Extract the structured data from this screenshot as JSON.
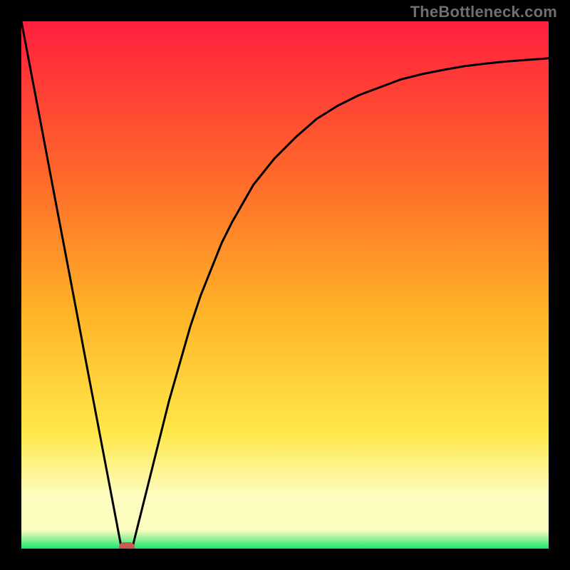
{
  "watermark": "TheBottleneck.com",
  "colors": {
    "frame": "#000000",
    "gradient_top": "#ff1f3e",
    "gradient_mid1": "#ff6a2a",
    "gradient_mid2": "#ffb327",
    "gradient_mid3": "#ffe84a",
    "gradient_lightband": "#fdfdc0",
    "gradient_bottom": "#17e86b",
    "curve": "#000000",
    "watermark": "#6f6f6f",
    "marker": "#c95b54"
  },
  "chart_data": {
    "type": "line",
    "title": "",
    "xlabel": "",
    "ylabel": "",
    "xlim": [
      0,
      100
    ],
    "ylim": [
      0,
      100
    ],
    "x": [
      0,
      2,
      4,
      6,
      8,
      10,
      12,
      14,
      16,
      18,
      19,
      20,
      21,
      22,
      24,
      26,
      28,
      30,
      32,
      34,
      36,
      38,
      40,
      44,
      48,
      52,
      56,
      60,
      64,
      68,
      72,
      76,
      80,
      84,
      88,
      92,
      96,
      100
    ],
    "values": [
      100,
      89.5,
      79,
      68.4,
      57.9,
      47.4,
      36.8,
      26.3,
      15.8,
      5.3,
      0,
      0,
      0,
      4,
      12,
      20,
      28,
      35,
      42,
      48,
      53,
      58,
      62,
      69,
      74,
      78,
      81.5,
      84,
      86,
      87.5,
      89,
      90,
      90.8,
      91.5,
      92,
      92.4,
      92.7,
      93
    ],
    "marker": {
      "x": 20,
      "y": 0
    },
    "legend": [],
    "grid": false
  }
}
